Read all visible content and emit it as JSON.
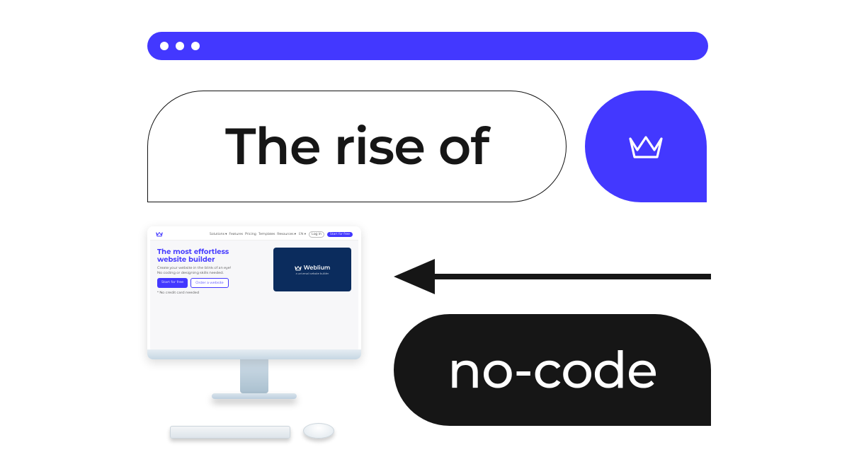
{
  "colors": {
    "blue": "#4338ff",
    "black": "#161616",
    "panel": "#0b2c5d"
  },
  "heading": {
    "text": "The rise of"
  },
  "nocode": {
    "text": "no-code"
  },
  "logo_badge": {
    "icon_name": "weblium-crown-icon"
  },
  "arrow": {
    "icon_name": "arrow-left-icon"
  },
  "monitor": {
    "nav": {
      "logo_glyph": "W",
      "links": [
        "Solutions ▾",
        "Features",
        "Pricing",
        "Templates",
        "Resources ▾"
      ],
      "lang": "EN ▾",
      "login_label": "Log in",
      "cta_label": "Start for free"
    },
    "hero": {
      "headline_line1": "The most effortless",
      "headline_line2": "website builder",
      "sub_line1": "Create your website in the blink of an eye!",
      "sub_line2": "No coding or designing skills needed.",
      "primary_btn": "Start for free",
      "secondary_btn": "Order a website",
      "note": "* No credit card needed"
    },
    "card": {
      "brand": "Weblium",
      "tagline": "a universal website builder"
    }
  }
}
